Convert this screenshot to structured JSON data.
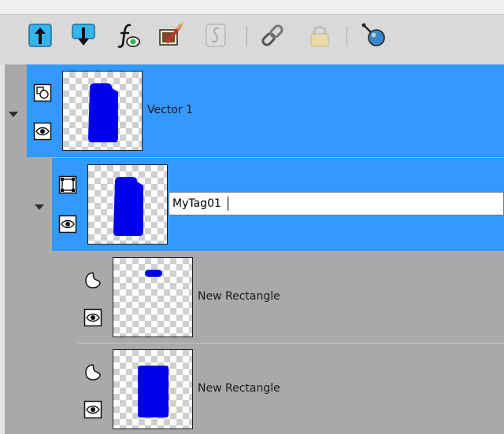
{
  "toolbar": {
    "buttons": [
      {
        "name": "move-layer-up-icon"
      },
      {
        "name": "move-layer-down-icon"
      },
      {
        "name": "layer-effects-icon"
      },
      {
        "name": "paint-layer-icon"
      },
      {
        "name": "vector-layer-disabled-icon"
      },
      {
        "name": "link-layers-icon"
      },
      {
        "name": "lock-layer-icon"
      },
      {
        "name": "layer-tag-icon"
      }
    ]
  },
  "layers": [
    {
      "id": "vector-1",
      "name": "Vector 1",
      "type": "vector",
      "selected": true,
      "expanded": true,
      "visible": true
    },
    {
      "id": "mytag01",
      "name": "MyTag01",
      "type": "group",
      "selected": true,
      "expanded": true,
      "visible": true,
      "editing": true
    },
    {
      "id": "rect-1",
      "name": "New Rectangle",
      "type": "shape",
      "selected": false,
      "visible": true
    },
    {
      "id": "rect-2",
      "name": "New Rectangle",
      "type": "shape",
      "selected": false,
      "visible": true
    }
  ],
  "colors": {
    "selection": "#3399ff",
    "panel": "#a9a9a9",
    "toolbar": "#d9d9d9",
    "shape_fill": "#0000ee"
  }
}
